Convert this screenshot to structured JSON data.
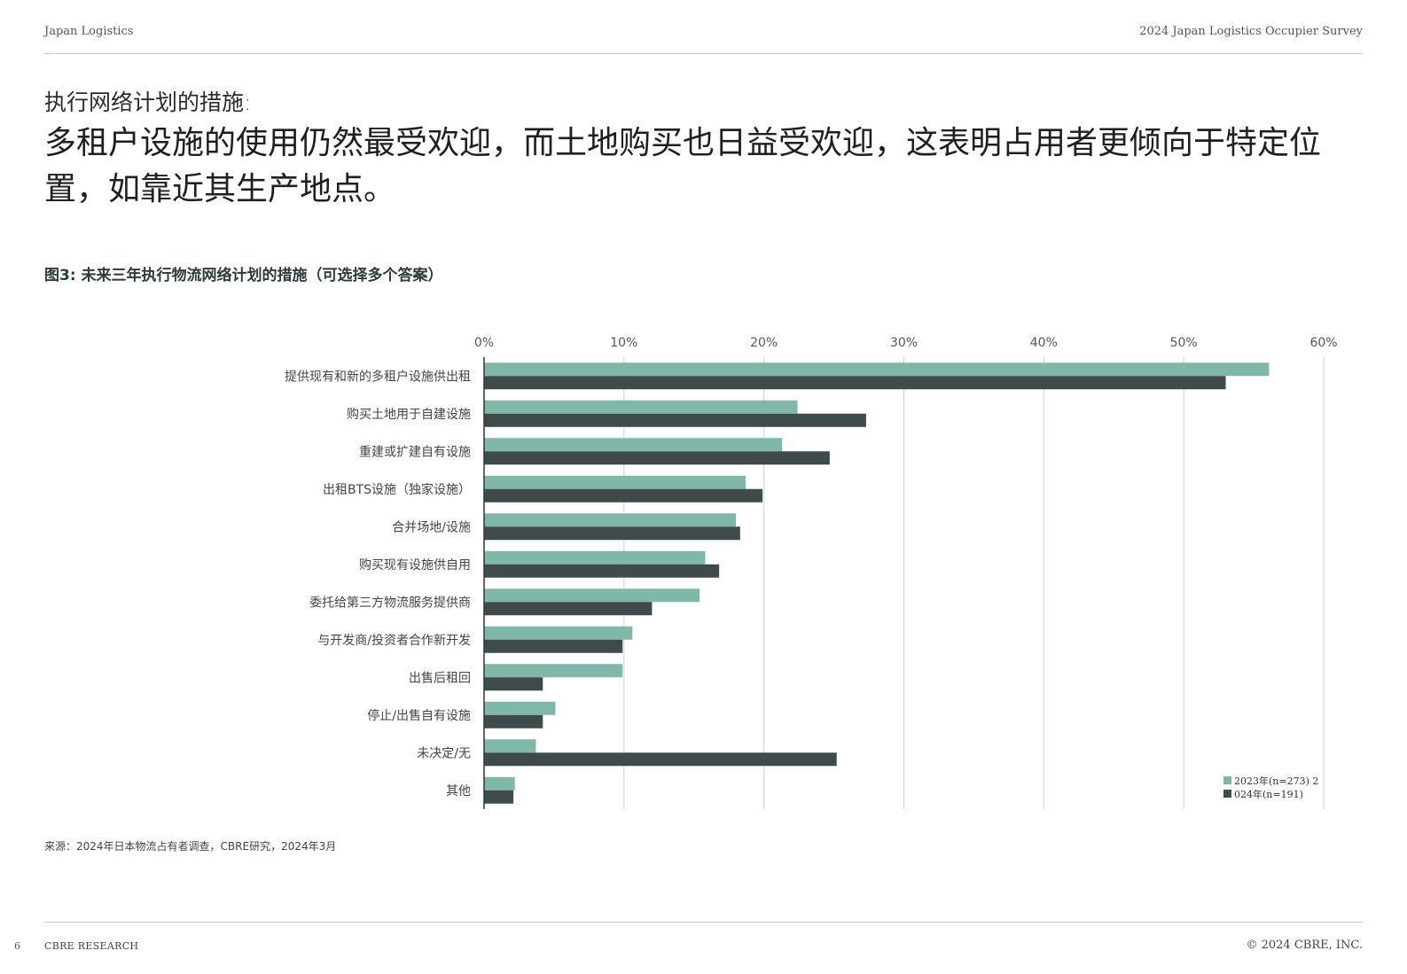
{
  "header": {
    "left": "Japan Logistics",
    "right": "2024 Japan Logistics Occupier Survey"
  },
  "subtitle": "执行网络计划的措施:",
  "headline": "多租户设施的使用仍然最受欢迎，而土地购买也日益受欢迎，这表明占用者更倾向于特定位置，如靠近其生产地点。",
  "figure_title": "图3: 未来三年执行物流网络计划的措施（可选择多个答案）",
  "chart_data": {
    "type": "bar",
    "orientation": "horizontal",
    "title": "图3: 未来三年执行物流网络计划的措施（可选择多个答案）",
    "categories": [
      "提供现有和新的多租户设施供出租",
      "购买土地用于自建设施",
      "重建或扩建自有设施",
      "出租BTS设施（独家设施）",
      "合并场地/设施",
      "购买现有设施供自用",
      "委托给第三方物流服务提供商",
      "与开发商/投资者合作新开发",
      "出售后租回",
      "停止/出售自有设施",
      "未决定/无",
      "其他"
    ],
    "series": [
      {
        "name": "2023年(n=273) 2",
        "color": "#7fb8a8",
        "values": [
          56.1,
          22.4,
          21.3,
          18.7,
          18.0,
          15.8,
          15.4,
          10.6,
          9.9,
          5.1,
          3.7,
          2.2
        ]
      },
      {
        "name": "024年(n=191)",
        "color": "#3f4b4b",
        "values": [
          53.0,
          27.3,
          24.7,
          19.9,
          18.3,
          16.8,
          12.0,
          9.9,
          4.2,
          4.2,
          25.2,
          2.1
        ]
      }
    ],
    "xlim": [
      0,
      60
    ],
    "xticks": [
      0,
      10,
      20,
      30,
      40,
      50,
      60
    ],
    "xtick_labels": [
      "0%",
      "10%",
      "20%",
      "30%",
      "40%",
      "50%",
      "60%"
    ],
    "grid": true,
    "legend_position": "bottom-right"
  },
  "source": "来源：2024年日本物流占有者调查，CBRE研究，2024年3月",
  "footer": {
    "page_number": "6",
    "left": "CBRE RESEARCH",
    "right": "© 2024 CBRE, INC."
  }
}
